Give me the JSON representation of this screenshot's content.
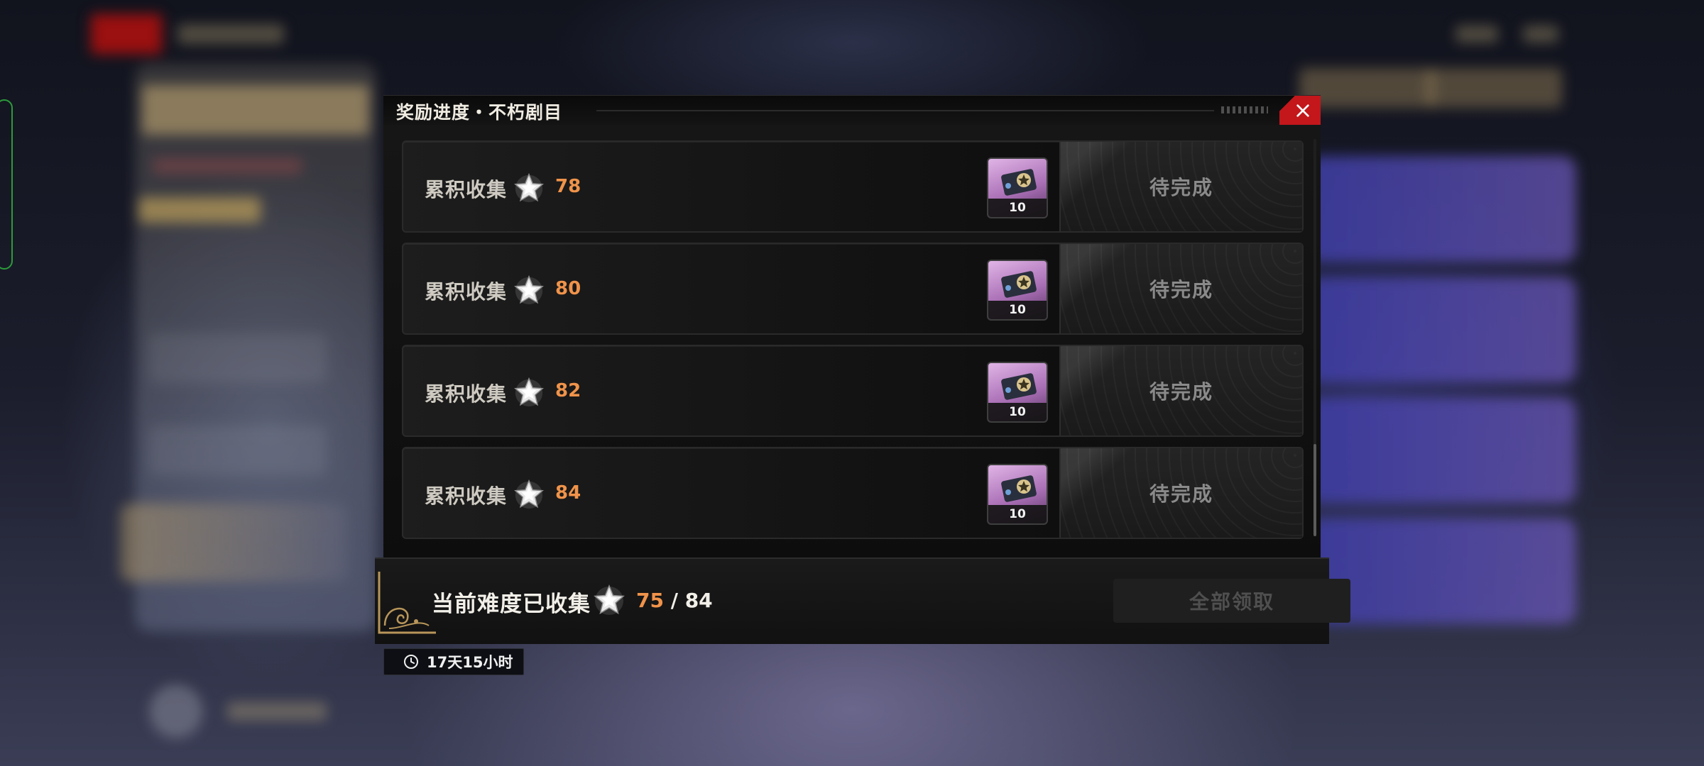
{
  "dialog": {
    "title": "奖励进度・不朽剧目",
    "close_icon": "close-icon"
  },
  "milestones": [
    {
      "label": "累积收集",
      "required": "78",
      "reward_qty": "10",
      "status": "待完成"
    },
    {
      "label": "累积收集",
      "required": "80",
      "reward_qty": "10",
      "status": "待完成"
    },
    {
      "label": "累积收集",
      "required": "82",
      "reward_qty": "10",
      "status": "待完成"
    },
    {
      "label": "累积收集",
      "required": "84",
      "reward_qty": "10",
      "status": "待完成"
    }
  ],
  "footer": {
    "label": "当前难度已收集",
    "collected": "75",
    "separator": " / ",
    "total": "84",
    "claim_all_label": "全部领取"
  },
  "timer": {
    "text": "17天15小时",
    "icon": "clock-icon"
  },
  "colors": {
    "accent_orange": "#f0934a",
    "close_red": "#c3171c",
    "reward_pink": "#c48ad0"
  }
}
